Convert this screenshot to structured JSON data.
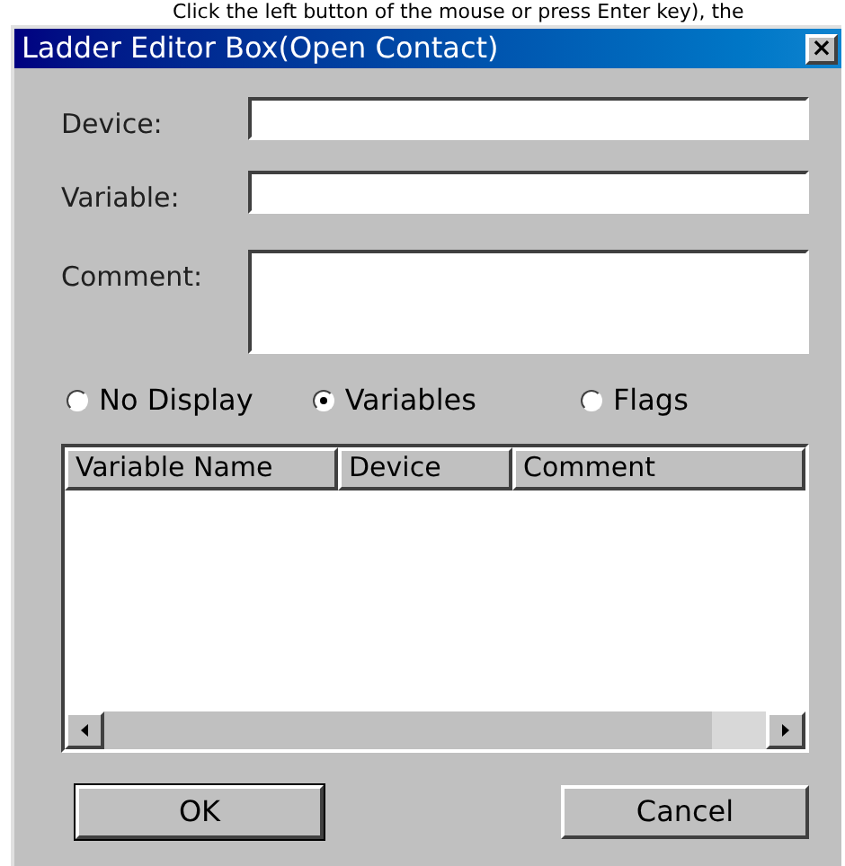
{
  "background_text": "Click the left button of the mouse or press Enter key), the",
  "window": {
    "title": "Ladder Editor Box(Open Contact)",
    "close": "×"
  },
  "fields": [
    {
      "label": "Device:",
      "kind": "line"
    },
    {
      "label": "Variable:",
      "kind": "line"
    },
    {
      "label": "Comment:",
      "kind": "area"
    }
  ],
  "display_options": [
    {
      "label": "No Display",
      "selected": false
    },
    {
      "label": "Variables",
      "selected": true
    },
    {
      "label": "Flags",
      "selected": false
    }
  ],
  "table": {
    "columns": [
      "Variable Name",
      "Device",
      "Comment"
    ]
  },
  "buttons": [
    {
      "label": "OK",
      "default": true
    },
    {
      "label": "Cancel",
      "default": false
    }
  ]
}
